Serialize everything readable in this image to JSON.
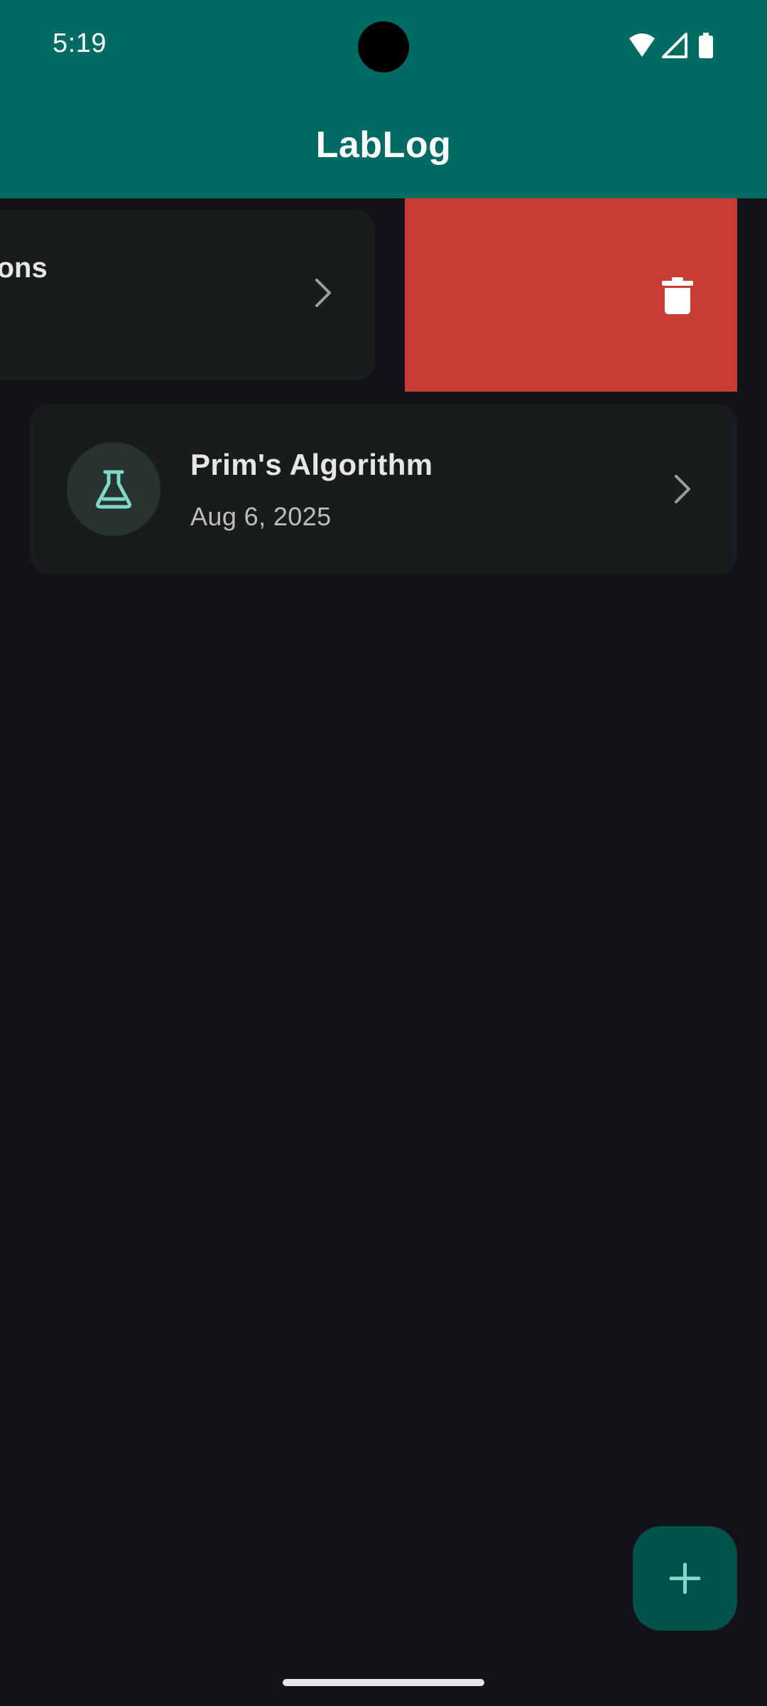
{
  "status_bar": {
    "time": "5:19"
  },
  "app_bar": {
    "title": "LabLog"
  },
  "entries": [
    {
      "title_visible": "ssions",
      "state": "swiped-left",
      "action": "delete",
      "action_color": "#c83c33",
      "icon": "trash-icon"
    },
    {
      "title": "Prim's Algorithm",
      "date": "Aug 6, 2025",
      "icon": "flask-icon"
    }
  ],
  "fab": {
    "icon": "plus-icon"
  },
  "colors": {
    "primary": "#006b62",
    "background": "#141218",
    "card": "#191c1c",
    "accent": "#7fd9c8",
    "danger": "#c83c33"
  }
}
